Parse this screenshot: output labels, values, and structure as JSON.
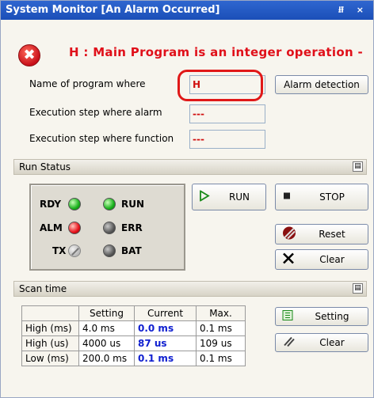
{
  "window": {
    "title": "System Monitor [An Alarm Occurred]",
    "title_buttons": "⭿ ×"
  },
  "alarm": {
    "icon_glyph": "✖",
    "message": "H : Main Program is an integer operation -"
  },
  "fields": {
    "program_name": {
      "label": "Name of program where",
      "value": "H"
    },
    "alarm_step": {
      "label": "Execution step where alarm",
      "value": "---"
    },
    "function_step": {
      "label": "Execution step where function",
      "value": "---"
    }
  },
  "buttons": {
    "alarm_detection": "Alarm detection",
    "run": "RUN",
    "stop": "STOP",
    "reset": "Reset",
    "clear": "Clear",
    "scan_setting": "Setting",
    "scan_clear": "Clear"
  },
  "run_status": {
    "header": "Run Status",
    "pin_glyph": "▤",
    "leds": [
      {
        "label": "RDY",
        "state": "green"
      },
      {
        "label": "RUN",
        "state": "green"
      },
      {
        "label": "ALM",
        "state": "red"
      },
      {
        "label": "ERR",
        "state": "gray"
      },
      {
        "label": "TX",
        "state": "disabled"
      },
      {
        "label": "BAT",
        "state": "gray"
      }
    ]
  },
  "scan_time": {
    "header": "Scan time",
    "pin_glyph": "▤",
    "columns": [
      "",
      "Setting",
      "Current",
      "Max."
    ],
    "rows": [
      [
        "High (ms)",
        "4.0 ms",
        "0.0 ms",
        "0.1 ms"
      ],
      [
        "High (us)",
        "4000 us",
        "87 us",
        "109 us"
      ],
      [
        "Low (ms)",
        "200.0 ms",
        "0.1 ms",
        "0.1 ms"
      ]
    ]
  },
  "colors": {
    "title_bar": "#1b4fb8",
    "alarm_red": "#e0101a",
    "current_blue": "#1020d0"
  }
}
